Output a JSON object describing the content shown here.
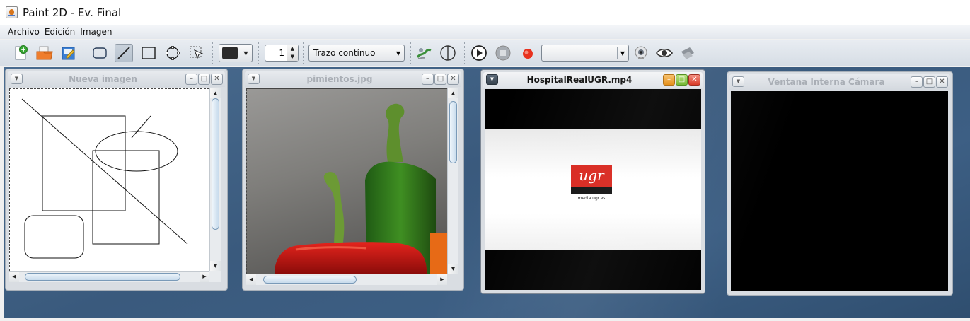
{
  "window": {
    "title": "Paint 2D - Ev. Final"
  },
  "menu": {
    "items": [
      "Archivo",
      "Edición",
      "Imagen"
    ]
  },
  "toolbar": {
    "stroke_width": "1",
    "stroke_style": "Trazo contínuo",
    "camera_select": "",
    "fill_color": "#2a2a2a"
  },
  "frames": [
    {
      "title": "Nueva imagen",
      "active": false
    },
    {
      "title": "pimientos.jpg",
      "active": false
    },
    {
      "title": "HospitalRealUGR.mp4",
      "active": true
    },
    {
      "title": "Ventana Interna Cámara",
      "active": false
    }
  ],
  "video": {
    "logo_text": "ugr",
    "logo_sub": "",
    "url_text": "media.ugr.es"
  },
  "colors": {
    "desktop": "#3f6186",
    "accent_orange": "#e58b10",
    "accent_green": "#6fb52c",
    "accent_red": "#d7321f"
  }
}
